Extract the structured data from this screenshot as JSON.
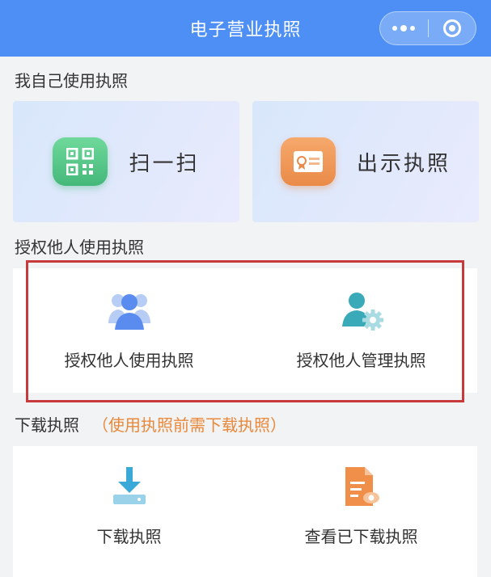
{
  "navbar": {
    "title": "电子营业执照",
    "more_icon": "more-dots-icon",
    "close_icon": "target-circle-icon"
  },
  "self_section": {
    "title": "我自己使用执照",
    "cards": [
      {
        "label": "扫一扫",
        "icon": "qr-code-icon"
      },
      {
        "label": "出示执照",
        "icon": "license-card-icon"
      }
    ]
  },
  "authorize_section": {
    "title": "授权他人使用执照",
    "items": [
      {
        "label": "授权他人使用执照",
        "icon": "users-icon"
      },
      {
        "label": "授权他人管理执照",
        "icon": "user-gear-icon"
      }
    ]
  },
  "download_section": {
    "title": "下载执照",
    "note": "（使用执照前需下载执照）",
    "items": [
      {
        "label": "下载执照",
        "icon": "download-icon"
      },
      {
        "label": "查看已下载执照",
        "icon": "document-view-icon"
      }
    ]
  },
  "colors": {
    "navbar": "#4d8ff5",
    "note": "#e8883a",
    "highlight": "#c8393b",
    "icon_blue": "#5a8cf0",
    "icon_teal": "#3aa9b8",
    "icon_orange": "#ef8f4a"
  }
}
